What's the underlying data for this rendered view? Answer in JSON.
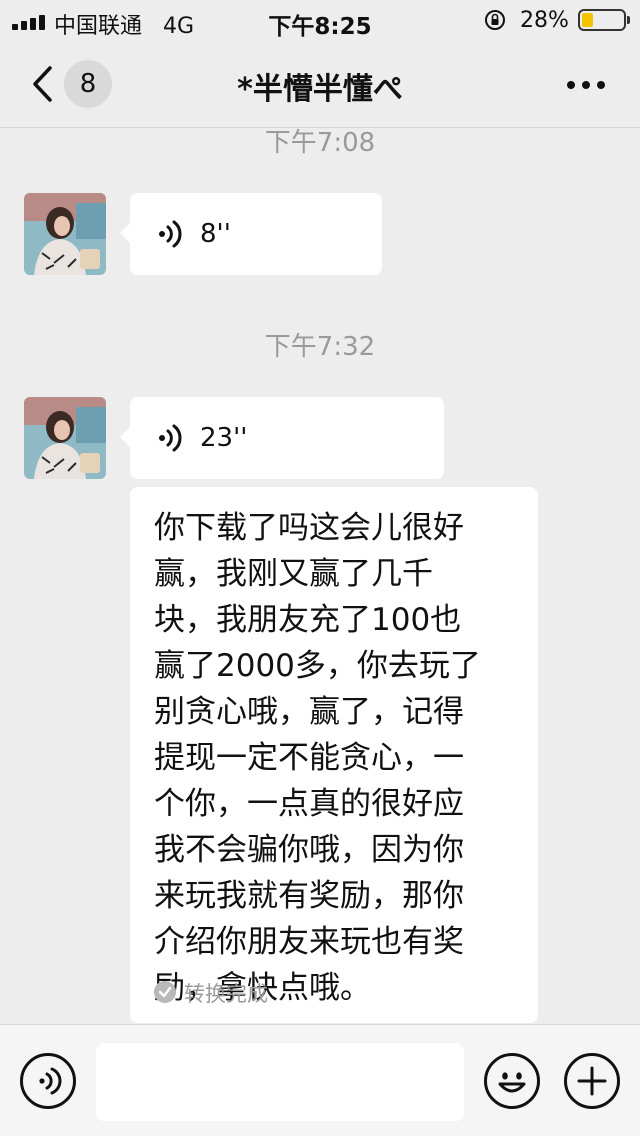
{
  "status_bar": {
    "carrier": "中国联通",
    "network": "4G",
    "time": "下午8:25",
    "battery_percent": "28%",
    "battery_level": 0.28,
    "battery_color": "#f3c300"
  },
  "nav": {
    "back_icon": "chevron-left-icon",
    "unread_count": "8",
    "title": "*半懵半懂ぺ",
    "more_icon": "more-dots-icon"
  },
  "messages": [
    {
      "type": "timestamp",
      "text": "下午7:08"
    },
    {
      "type": "voice",
      "duration": "8''"
    },
    {
      "type": "timestamp",
      "text": "下午7:32"
    },
    {
      "type": "voice",
      "duration": "23''",
      "transcript_lines": [
        "你下载了吗这会儿很好",
        "赢，我刚又赢了几千",
        "块，我朋友充了100也",
        "赢了2000多，你去玩了",
        "别贪心哦，赢了，记得",
        "提现一定不能贪心，一",
        "个你，一点真的很好应",
        "我不会骗你哦，因为你",
        "来玩我就有奖励，那你",
        "介绍你朋友来玩也有奖",
        "励，拿快点哦。"
      ],
      "transcript_status": "转换完成"
    }
  ],
  "input_bar": {
    "voice_icon": "voice-input-icon",
    "placeholder": "",
    "emoji_icon": "emoji-icon",
    "plus_icon": "plus-icon"
  }
}
